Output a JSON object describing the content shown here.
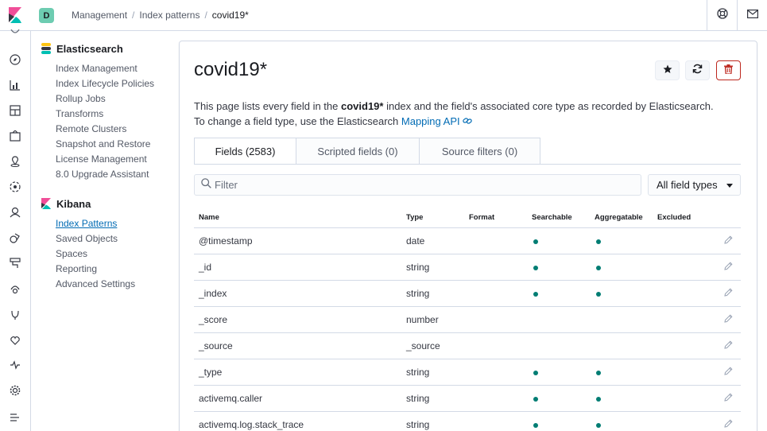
{
  "header": {
    "space_initial": "D",
    "space_color": "#6dccb1",
    "breadcrumbs": [
      "Management",
      "Index patterns",
      "covid19*"
    ],
    "help_icon": "help-menu-icon",
    "mail_icon": "mail-icon"
  },
  "rail": {
    "icons": [
      "recently-viewed-icon",
      "discover-icon",
      "visualize-icon",
      "dashboard-icon",
      "canvas-icon",
      "maps-icon",
      "ml-icon",
      "siem-icon",
      "logs-icon",
      "infrastructure-icon",
      "apm-icon",
      "uptime-icon",
      "dev-tools-icon",
      "monitoring-icon",
      "management-icon",
      "collapse-icon"
    ]
  },
  "sidenav": {
    "elasticsearch": {
      "title": "Elasticsearch",
      "items": [
        "Index Management",
        "Index Lifecycle Policies",
        "Rollup Jobs",
        "Transforms",
        "Remote Clusters",
        "Snapshot and Restore",
        "License Management",
        "8.0 Upgrade Assistant"
      ]
    },
    "kibana": {
      "title": "Kibana",
      "items": [
        "Index Patterns",
        "Saved Objects",
        "Spaces",
        "Reporting",
        "Advanced Settings"
      ],
      "active": "Index Patterns"
    }
  },
  "page": {
    "title": "covid19*",
    "desc_part1": "This page lists every field in the ",
    "desc_bold": "covid19*",
    "desc_part2": " index and the field's associated core type as recorded by Elasticsearch.",
    "desc_line2": "To change a field type, use the Elasticsearch ",
    "desc_link": "Mapping API",
    "star_icon": "star-icon",
    "refresh_icon": "refresh-icon",
    "delete_icon": "trash-icon"
  },
  "tabs": [
    {
      "label": "Fields (2583)",
      "active": true
    },
    {
      "label": "Scripted fields (0)",
      "active": false
    },
    {
      "label": "Source filters (0)",
      "active": false
    }
  ],
  "filter": {
    "placeholder": "Filter",
    "value": ""
  },
  "type_select": {
    "value": "All field types"
  },
  "table": {
    "columns": [
      "Name",
      "Type",
      "Format",
      "Searchable",
      "Aggregatable",
      "Excluded"
    ],
    "rows": [
      {
        "name": "@timestamp",
        "type": "date",
        "format": "",
        "searchable": true,
        "aggregatable": true,
        "excluded": false
      },
      {
        "name": "_id",
        "type": "string",
        "format": "",
        "searchable": true,
        "aggregatable": true,
        "excluded": false
      },
      {
        "name": "_index",
        "type": "string",
        "format": "",
        "searchable": true,
        "aggregatable": true,
        "excluded": false
      },
      {
        "name": "_score",
        "type": "number",
        "format": "",
        "searchable": false,
        "aggregatable": false,
        "excluded": false
      },
      {
        "name": "_source",
        "type": "_source",
        "format": "",
        "searchable": false,
        "aggregatable": false,
        "excluded": false
      },
      {
        "name": "_type",
        "type": "string",
        "format": "",
        "searchable": true,
        "aggregatable": true,
        "excluded": false
      },
      {
        "name": "activemq.caller",
        "type": "string",
        "format": "",
        "searchable": true,
        "aggregatable": true,
        "excluded": false
      },
      {
        "name": "activemq.log.stack_trace",
        "type": "string",
        "format": "",
        "searchable": true,
        "aggregatable": true,
        "excluded": false
      }
    ]
  },
  "colors": {
    "accent": "#006bb4",
    "dot": "#017d73",
    "danger": "#bd271e"
  }
}
